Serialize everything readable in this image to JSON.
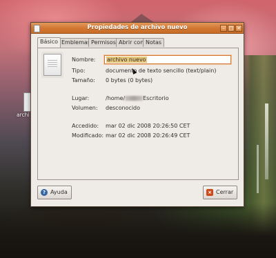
{
  "window": {
    "title": "Propiedades de archivo nuevo"
  },
  "desktop": {
    "icon_label": "archi"
  },
  "tabs": [
    {
      "label": "Básico",
      "active": true
    },
    {
      "label": "Emblemas"
    },
    {
      "label": "Permisos"
    },
    {
      "label": "Abrir con"
    },
    {
      "label": "Notas"
    }
  ],
  "basic": {
    "name_label": "Nombre:",
    "name_value": "archivo nuevo",
    "type_label": "Tipo:",
    "type_value": "documento de texto sencillo (text/plain)",
    "size_label": "Tamaño:",
    "size_value": "0 bytes (0 bytes)",
    "location_label": "Lugar:",
    "location_prefix": "/home/",
    "location_suffix": "Escritorio",
    "volume_label": "Volumen:",
    "volume_value": "desconocido",
    "accessed_label": "Accedido:",
    "accessed_value": "mar 02 dic 2008 20:26:50 CET",
    "modified_label": "Modificado:",
    "modified_value": "mar 02 dic 2008 20:26:49 CET"
  },
  "buttons": {
    "help": "Ayuda",
    "close": "Cerrar"
  },
  "icons": {
    "window": "text-file-icon",
    "help": "help-icon",
    "close": "close-x-icon",
    "file": "text-file-icon"
  },
  "colors": {
    "titlebar": "#d27834",
    "help_icon": "#3465a4",
    "close_icon": "#cc4a1a",
    "selection": "#e7c77a"
  }
}
